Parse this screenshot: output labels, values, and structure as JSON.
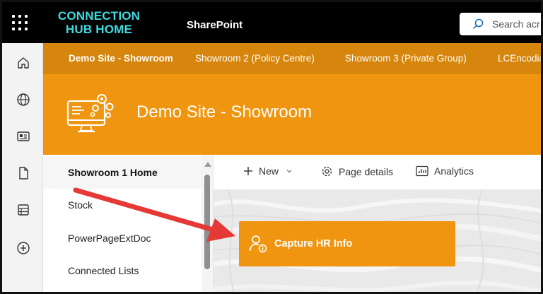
{
  "suite": {
    "brand_line1": "CONNECTION",
    "brand_line2": "HUB HOME",
    "app_name": "SharePoint",
    "search_placeholder": "Search acr",
    "colors": {
      "bar": "#000000",
      "brand": "#3fd9e0"
    }
  },
  "appbar": {
    "icons": [
      "home-icon",
      "globe-icon",
      "news-icon",
      "file-icon",
      "list-icon",
      "add-icon"
    ]
  },
  "hub_nav": {
    "items": [
      {
        "label": "Demo Site - Showroom",
        "active": true
      },
      {
        "label": "Showroom 2 (Policy Centre)"
      },
      {
        "label": "Showroom 3 (Private Group)"
      },
      {
        "label": "LCEncodia"
      }
    ],
    "color": "#d6860c"
  },
  "site": {
    "title": "Demo Site - Showroom",
    "header_color": "#f0950f",
    "logo_icon": "computer-gears-icon"
  },
  "left_nav": {
    "items": [
      {
        "label": "Showroom 1 Home",
        "selected": true
      },
      {
        "label": "Stock"
      },
      {
        "label": "PowerPageExtDoc"
      },
      {
        "label": "Connected Lists"
      }
    ]
  },
  "command_bar": {
    "new_label": "New",
    "page_details_label": "Page details",
    "analytics_label": "Analytics"
  },
  "content": {
    "hr_button_label": "Capture HR Info",
    "hr_button_icon": "person-info-icon",
    "annotation": "red-arrow-pointer"
  }
}
